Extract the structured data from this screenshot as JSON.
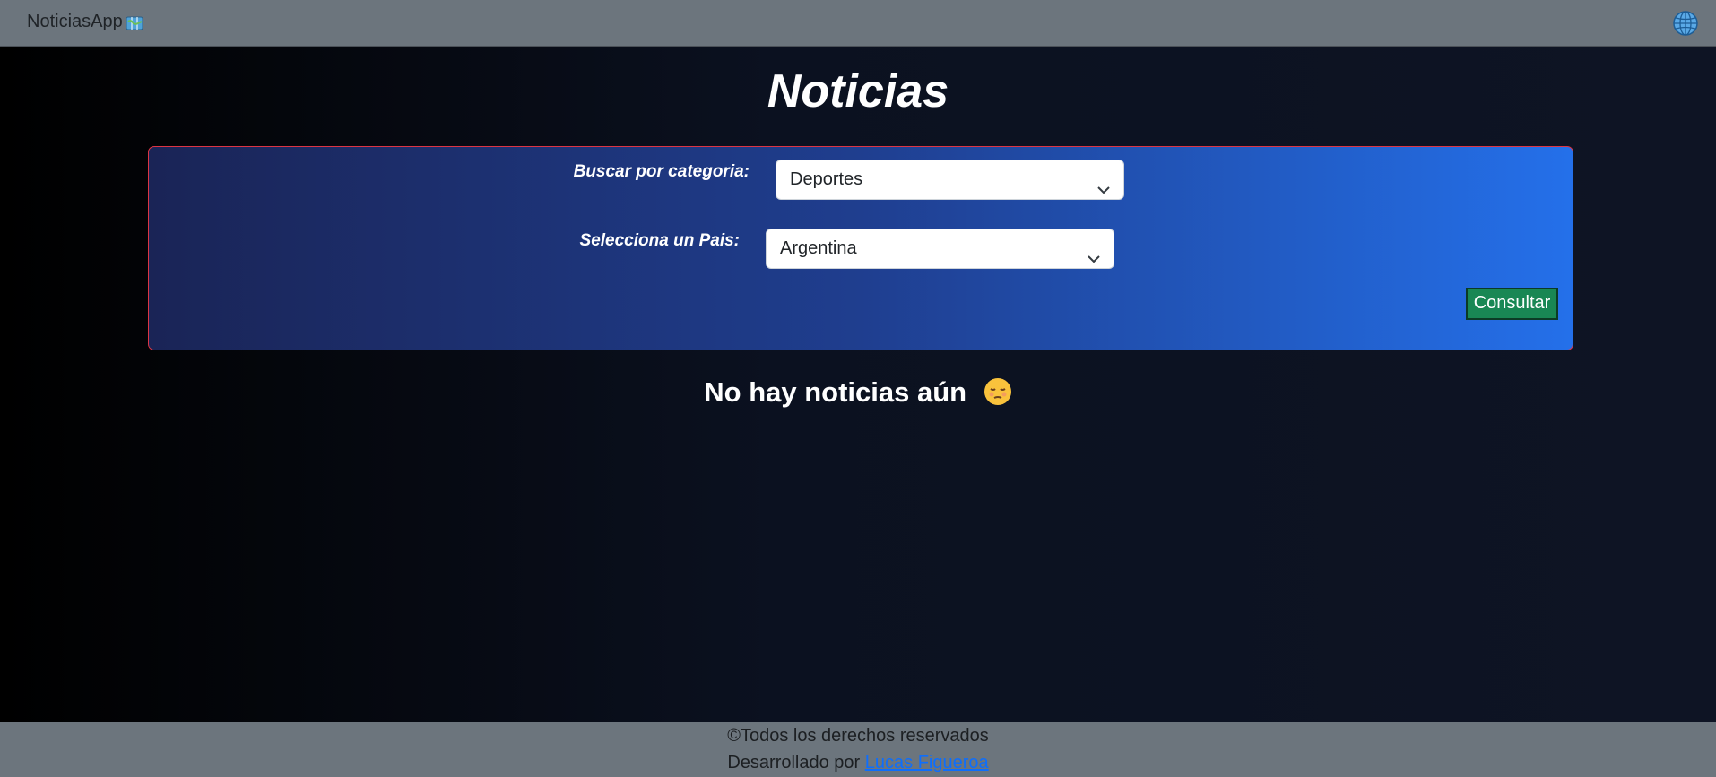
{
  "navbar": {
    "brand": "NoticiasApp",
    "brand_icon": "map-icon",
    "globe_icon": "globe-icon"
  },
  "page": {
    "title": "Noticias"
  },
  "form": {
    "category_label": "Buscar por categoria:",
    "category_value": "Deportes",
    "country_label": "Selecciona un Pais:",
    "country_value": "Argentina",
    "submit_label": "Consultar"
  },
  "empty_state": {
    "message": "No hay noticias aún",
    "icon": "pensive-face-icon"
  },
  "footer": {
    "copyright": "©Todos los derechos reservados",
    "dev_prefix": "Desarrollado por ",
    "dev_name": "Lucas Figueroa"
  },
  "colors": {
    "navbar": "#6c757d",
    "panel_border": "#dc3545",
    "panel_gradient_start": "#1a2456",
    "panel_gradient_end": "#2470ea",
    "button": "#198754",
    "link": "#0d6efd"
  }
}
